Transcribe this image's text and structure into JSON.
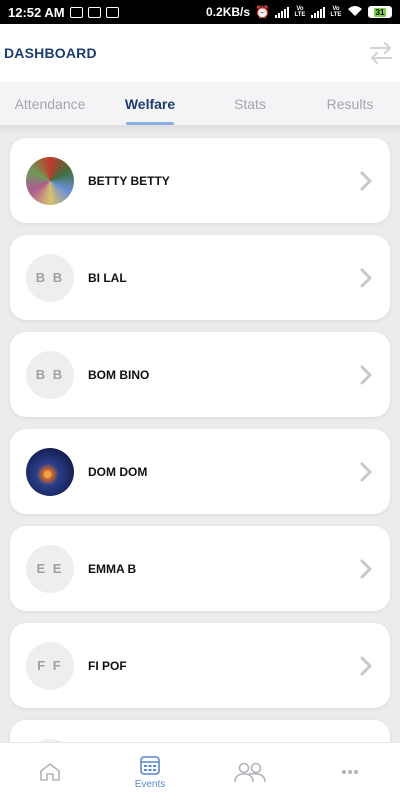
{
  "status_bar": {
    "time": "12:52 AM",
    "speed": "0.2KB/s",
    "battery": "31",
    "lte1": "Vo LTE",
    "lte2": "Vo LTE"
  },
  "header": {
    "title": "DASHBOARD",
    "action_icon": "swap-arrows-icon"
  },
  "tabs": [
    {
      "label": "Attendance",
      "active": false
    },
    {
      "label": "Welfare",
      "active": true
    },
    {
      "label": "Stats",
      "active": false
    },
    {
      "label": "Results",
      "active": false
    }
  ],
  "people": [
    {
      "name": "BETTY BETTY",
      "initials": "",
      "avatar": "photo"
    },
    {
      "name": "BI LAL",
      "initials": "B B",
      "avatar": "initials"
    },
    {
      "name": "BOM BINO",
      "initials": "B B",
      "avatar": "initials"
    },
    {
      "name": "DOM DOM",
      "initials": "",
      "avatar": "photo"
    },
    {
      "name": "EMMA B",
      "initials": "E E",
      "avatar": "initials"
    },
    {
      "name": "FI POF",
      "initials": "F F",
      "avatar": "initials"
    }
  ],
  "bottom_nav": [
    {
      "label": "",
      "icon": "home-icon"
    },
    {
      "label": "Events",
      "icon": "calendar-icon",
      "active": true
    },
    {
      "label": "",
      "icon": "people-icon"
    },
    {
      "label": "",
      "icon": "more-icon"
    }
  ],
  "colors": {
    "accent": "#1c3d6e",
    "tab_indicator": "#8aaee0",
    "nav_active": "#5b86c9",
    "background": "#ececee"
  }
}
